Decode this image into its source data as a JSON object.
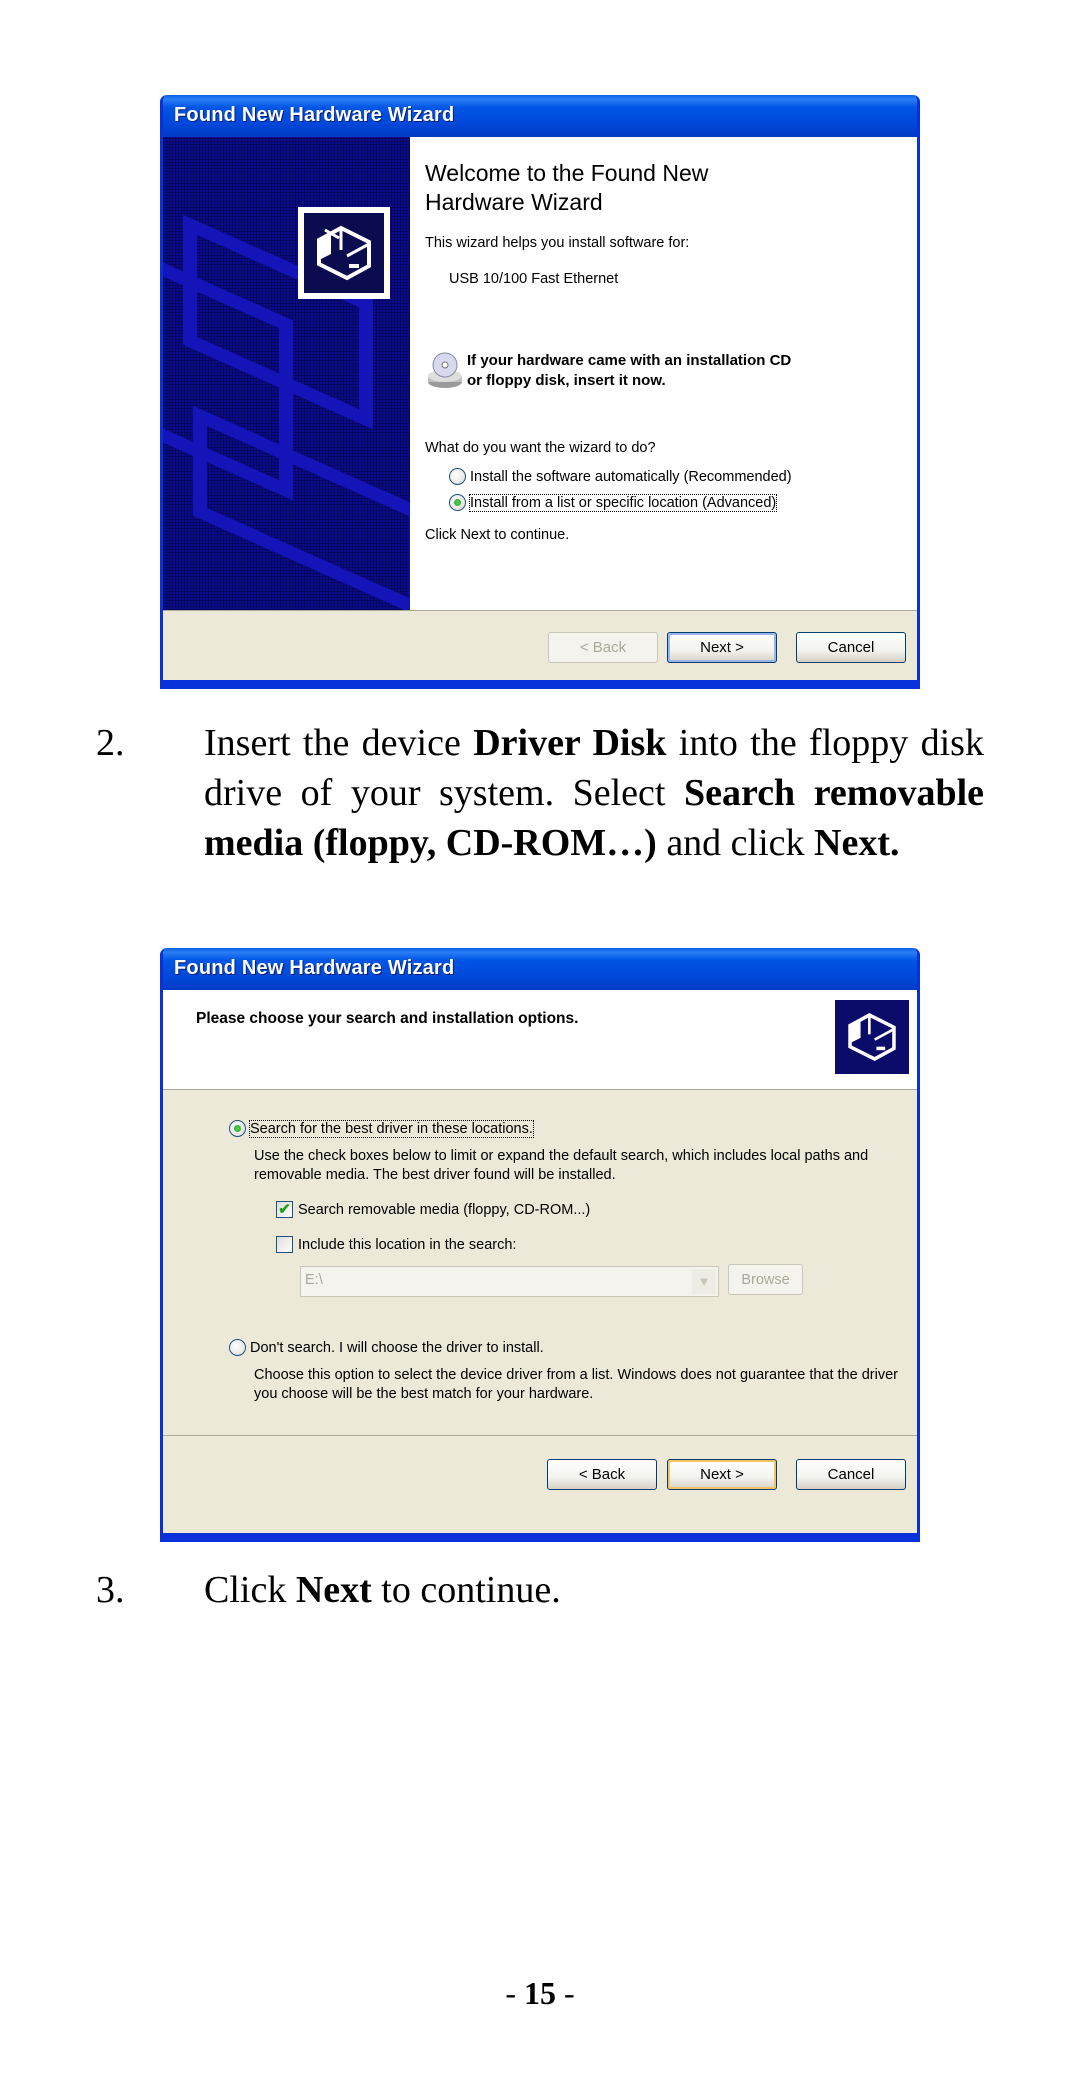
{
  "dialog1": {
    "title": "Found New Hardware Wizard",
    "heading_line1": "Welcome to the Found New",
    "heading_line2": "Hardware Wizard",
    "intro": "This wizard helps you install software for:",
    "device": "USB 10/100 Fast Ethernet",
    "cd_note_line1": "If your hardware came with an installation CD",
    "cd_note_line2": "or floppy disk, insert it now.",
    "question": "What do you want the wizard to do?",
    "options": [
      {
        "label": "Install the software automatically (Recommended)",
        "selected": false
      },
      {
        "label": "Install from a list or specific location (Advanced)",
        "selected": true
      }
    ],
    "continue_hint": "Click Next to continue.",
    "buttons": {
      "back": "< Back",
      "next": "Next >",
      "cancel": "Cancel"
    },
    "back_enabled": false
  },
  "step2": {
    "number": "2.",
    "text_1": "Insert the device ",
    "bold_1": "Driver Disk",
    "text_2": " into the floppy disk drive of your system.  Select ",
    "bold_2": "Search removable media (floppy, CD-ROM…)",
    "text_3": " and click ",
    "bold_3": "Next."
  },
  "dialog2": {
    "title": "Found New Hardware Wizard",
    "header": "Please choose your search and installation options.",
    "option_search": {
      "label": "Search for the best driver in these locations.",
      "selected": true
    },
    "search_desc": "Use the check boxes below to limit or expand the default search, which includes local paths and removable media. The best driver found will be installed.",
    "checkboxes": [
      {
        "label": "Search removable media (floppy, CD-ROM...)",
        "checked": true
      },
      {
        "label": "Include this location in the search:",
        "checked": false
      }
    ],
    "location_value": "E:\\",
    "browse_label": "Browse",
    "option_dont_search": {
      "label": "Don't search. I will choose the driver to install.",
      "selected": false
    },
    "dont_search_desc": "Choose this option to select the device driver from a list.  Windows does not guarantee that the driver you choose will be the best match for your hardware.",
    "buttons": {
      "back": "< Back",
      "next": "Next >",
      "cancel": "Cancel"
    }
  },
  "step3": {
    "number": "3.",
    "text_1": "Click ",
    "bold_1": "Next",
    "text_2": " to continue."
  },
  "page_number": {
    "prefix": "- ",
    "value": "15",
    "suffix": " -"
  }
}
